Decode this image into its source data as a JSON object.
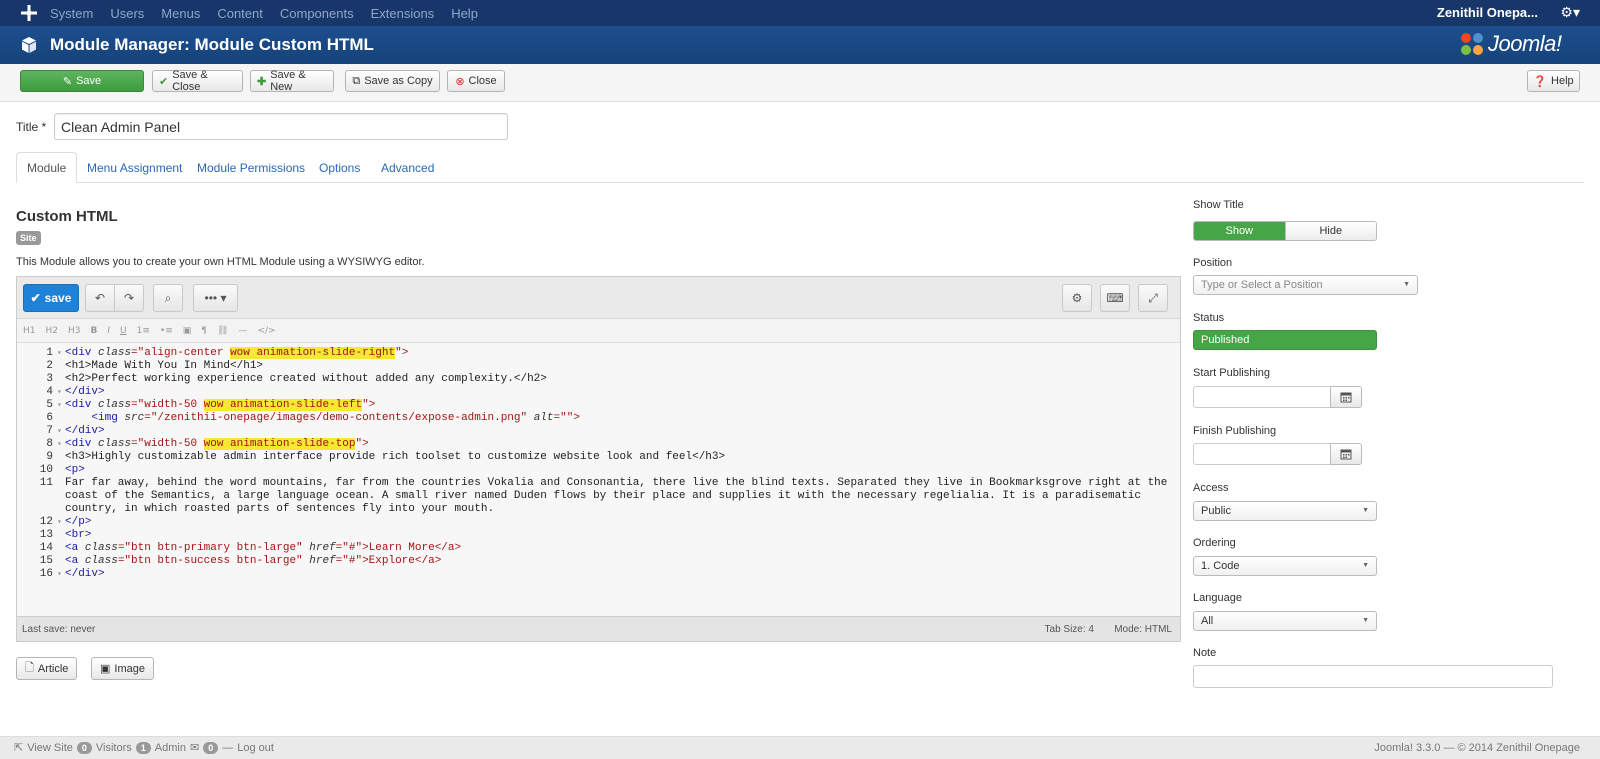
{
  "navbar": {
    "menu": [
      "System",
      "Users",
      "Menus",
      "Content",
      "Components",
      "Extensions",
      "Help"
    ],
    "site_link": "Zenithil Onepa...",
    "gear": "⚙▾"
  },
  "header": {
    "title": "Module Manager: Module Custom HTML",
    "logo_text": "Joomla!"
  },
  "toolbar": {
    "save": "Save",
    "save_close": "Save & Close",
    "save_new": "Save & New",
    "save_copy": "Save as Copy",
    "close": "Close",
    "help": "Help"
  },
  "form": {
    "title_label": "Title *",
    "title_value": "Clean Admin Panel"
  },
  "tabs": [
    "Module",
    "Menu Assignment",
    "Module Permissions",
    "Options",
    "Advanced"
  ],
  "module": {
    "heading": "Custom HTML",
    "badge": "Site",
    "description": "This Module allows you to create your own HTML Module using a WYSIWYG editor."
  },
  "editor": {
    "save_label": "save",
    "format_buttons": [
      "H1",
      "H2",
      "H3",
      "B",
      "I",
      "U",
      "1≡",
      "•≡",
      "▣",
      "¶",
      "⛓",
      "—",
      "</>"
    ],
    "status_left": "Last save: never",
    "tab_size": "Tab Size: 4",
    "mode": "Mode: HTML"
  },
  "code_lines": [
    {
      "n": "1",
      "f": "▾"
    },
    {
      "n": "2",
      "f": ""
    },
    {
      "n": "3",
      "f": ""
    },
    {
      "n": "4",
      "f": "▾"
    },
    {
      "n": "5",
      "f": "▾"
    },
    {
      "n": "6",
      "f": ""
    },
    {
      "n": "7",
      "f": "▾"
    },
    {
      "n": "8",
      "f": "▾"
    },
    {
      "n": "9",
      "f": ""
    },
    {
      "n": "10",
      "f": ""
    },
    {
      "n": "11",
      "f": ""
    },
    {
      "n": "12",
      "f": "▾"
    },
    {
      "n": "13",
      "f": ""
    },
    {
      "n": "14",
      "f": ""
    },
    {
      "n": "15",
      "f": ""
    },
    {
      "n": "16",
      "f": "▾"
    }
  ],
  "code": {
    "l1a": "<div ",
    "l1b": "class",
    "l1c": "=\"align-center ",
    "l1d": "wow animation-slide-right",
    "l1e": "\">",
    "l2": "<h1>Made With You In Mind</h1>",
    "l3": "<h2>Perfect working experience created without added any complexity.</h2>",
    "l4": "</div>",
    "l5a": "<div ",
    "l5b": "class",
    "l5c": "=\"width-50 ",
    "l5d": "wow animation-slide-left",
    "l5e": "\">",
    "l6a": "    <img ",
    "l6b": "src",
    "l6c": "=\"/zenithii-onepage/images/demo-contents/expose-admin.png\" ",
    "l6d": "alt",
    "l6e": "=\"\">",
    "l7": "</div>",
    "l8a": "<div ",
    "l8b": "class",
    "l8c": "=\"width-50 ",
    "l8d": "wow animation-slide-top",
    "l8e": "\">",
    "l9": "<h3>Highly customizable admin interface provide rich toolset to customize website look and feel</h3>",
    "l10": "<p>",
    "l11": "Far far away, behind the word mountains, far from the countries Vokalia and Consonantia, there live the blind texts. Separated they live in Bookmarksgrove right at the coast of the Semantics, a large language ocean. A small river named Duden flows by their place and supplies it with the necessary regelialia. It is a paradisematic country, in which roasted parts of sentences fly into your mouth.",
    "l12": "</p>",
    "l13": "<br>",
    "l14a": "<a ",
    "l14b": "class",
    "l14c": "=\"btn btn-primary btn-large\" ",
    "l14d": "href",
    "l14e": "=\"#\">Learn More</a>",
    "l15a": "<a ",
    "l15b": "class",
    "l15c": "=\"btn btn-success btn-large\" ",
    "l15d": "href",
    "l15e": "=\"#\">Explore</a>",
    "l16": "</div>"
  },
  "bottom_buttons": {
    "article": "Article",
    "image": "Image"
  },
  "sidebar": {
    "show_title_label": "Show Title",
    "show": "Show",
    "hide": "Hide",
    "position_label": "Position",
    "position_placeholder": "Type or Select a Position",
    "status_label": "Status",
    "status_value": "Published",
    "start_label": "Start Publishing",
    "finish_label": "Finish Publishing",
    "access_label": "Access",
    "access_value": "Public",
    "ordering_label": "Ordering",
    "ordering_value": "1. Code",
    "language_label": "Language",
    "language_value": "All",
    "note_label": "Note"
  },
  "footer": {
    "view_site": "View Site",
    "visitors_count": "0",
    "visitors": "Visitors",
    "admin_count": "1",
    "admin": "Admin",
    "msg_count": "0",
    "logout": "Log out",
    "right": "Joomla! 3.3.0 — © 2014 Zenithil Onepage"
  },
  "colors": {
    "navbar": "#17376a",
    "header": "#1d4f8e",
    "green": "#46a546",
    "blue": "#1e82d9",
    "highlight": "#f7e834"
  }
}
